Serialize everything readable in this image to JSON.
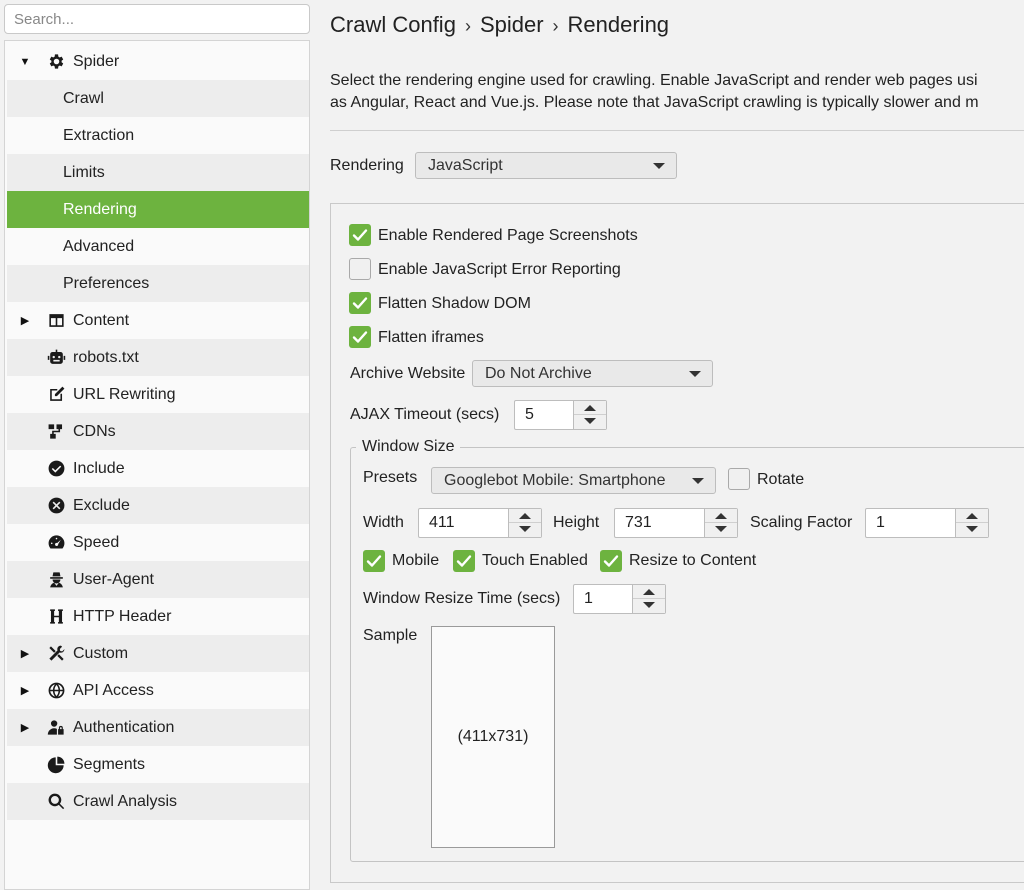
{
  "search": {
    "placeholder": "Search..."
  },
  "nav": {
    "items": [
      {
        "label": "Spider",
        "icon": "gear-icon",
        "arrow": "expanded"
      },
      {
        "label": "Crawl",
        "sub": true
      },
      {
        "label": "Extraction",
        "sub": true
      },
      {
        "label": "Limits",
        "sub": true
      },
      {
        "label": "Rendering",
        "sub": true,
        "selected": true
      },
      {
        "label": "Advanced",
        "sub": true
      },
      {
        "label": "Preferences",
        "sub": true
      },
      {
        "label": "Content",
        "icon": "columns-icon",
        "arrow": "collapsed"
      },
      {
        "label": "robots.txt",
        "icon": "robot-icon"
      },
      {
        "label": "URL Rewriting",
        "icon": "edit-icon"
      },
      {
        "label": "CDNs",
        "icon": "network-icon"
      },
      {
        "label": "Include",
        "icon": "check-circle-icon"
      },
      {
        "label": "Exclude",
        "icon": "x-circle-icon"
      },
      {
        "label": "Speed",
        "icon": "gauge-icon"
      },
      {
        "label": "User-Agent",
        "icon": "user-secret-icon"
      },
      {
        "label": "HTTP Header",
        "icon": "header-h-icon"
      },
      {
        "label": "Custom",
        "icon": "tools-icon",
        "arrow": "collapsed"
      },
      {
        "label": "API Access",
        "icon": "globe-icon",
        "arrow": "collapsed"
      },
      {
        "label": "Authentication",
        "icon": "user-lock-icon",
        "arrow": "collapsed"
      },
      {
        "label": "Segments",
        "icon": "pie-chart-icon"
      },
      {
        "label": "Crawl Analysis",
        "icon": "magnifier-icon"
      }
    ]
  },
  "breadcrumb": {
    "part1": "Crawl Config",
    "part2": "Spider",
    "part3": "Rendering",
    "separator": "›"
  },
  "description": {
    "line1": "Select the rendering engine used for crawling. Enable JavaScript and render web pages usi",
    "line2": "as Angular, React and Vue.js. Please note that JavaScript crawling is typically slower and m"
  },
  "rendering": {
    "label": "Rendering",
    "value": "JavaScript"
  },
  "options": {
    "screenshots": {
      "label": "Enable Rendered Page Screenshots",
      "checked": true
    },
    "js_errors": {
      "label": "Enable JavaScript Error Reporting",
      "checked": false
    },
    "shadow_dom": {
      "label": "Flatten Shadow DOM",
      "checked": true
    },
    "iframes": {
      "label": "Flatten iframes",
      "checked": true
    },
    "archive": {
      "label": "Archive Website",
      "value": "Do Not Archive"
    },
    "ajax": {
      "label": "AJAX Timeout (secs)",
      "value": "5"
    }
  },
  "window_size": {
    "legend": "Window Size",
    "presets_label": "Presets",
    "preset_value": "Googlebot Mobile: Smartphone",
    "rotate": {
      "label": "Rotate",
      "checked": false
    },
    "width_label": "Width",
    "width_value": "411",
    "height_label": "Height",
    "height_value": "731",
    "scaling_label": "Scaling Factor",
    "scaling_value": "1",
    "mobile": {
      "label": "Mobile",
      "checked": true
    },
    "touch": {
      "label": "Touch Enabled",
      "checked": true
    },
    "resize": {
      "label": "Resize to Content",
      "checked": true
    },
    "resize_time_label": "Window Resize Time (secs)",
    "resize_time_value": "1",
    "sample_label": "Sample",
    "sample_text": "(411x731)"
  },
  "colors": {
    "accent": "#6db33f",
    "background": "#f2f2f2"
  }
}
